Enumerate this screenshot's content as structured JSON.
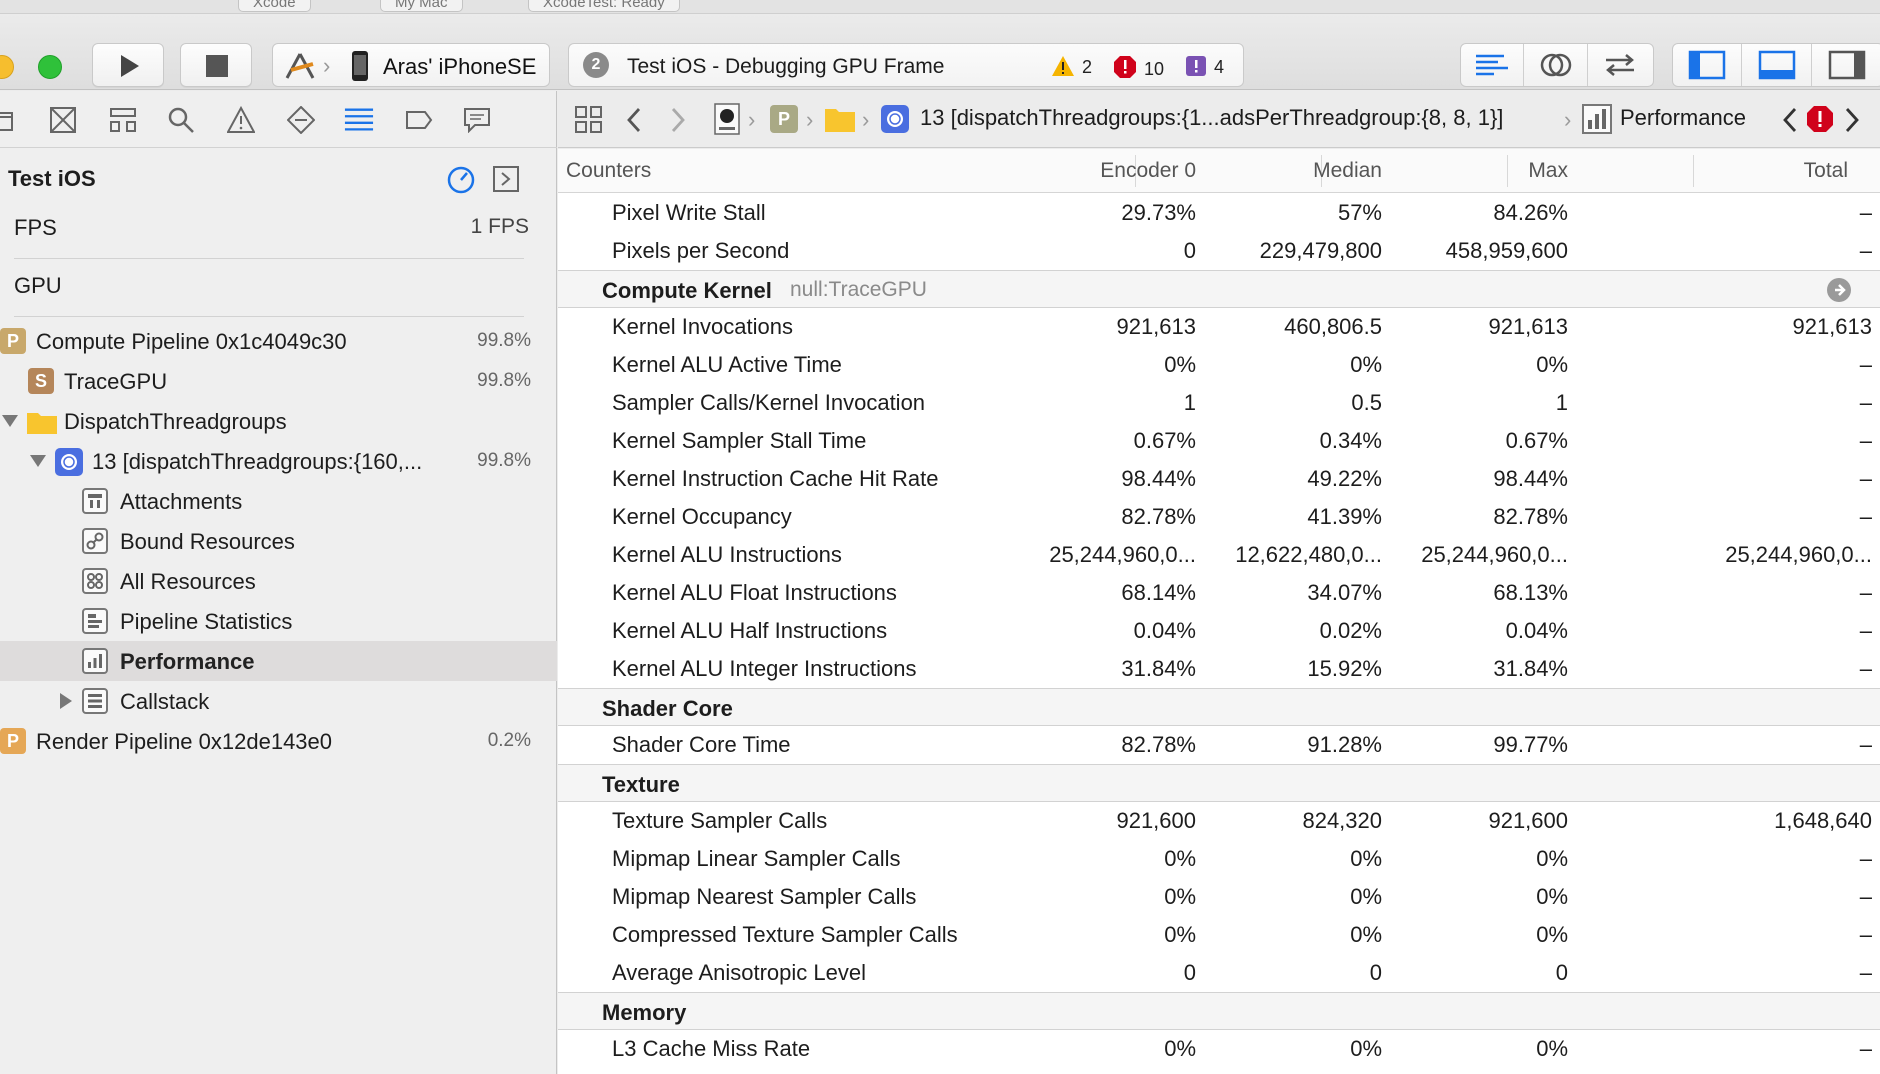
{
  "top_tabs": [
    "Xcode",
    "My Mac",
    "XcodeTest: Ready"
  ],
  "toolbar": {
    "device": "Aras' iPhoneSE",
    "activity_number": "2",
    "activity_status": "Test iOS - Debugging GPU Frame",
    "warnings": "2",
    "errors": "10",
    "issues": "4"
  },
  "navigator": {
    "title": "Test iOS",
    "fps_label": "FPS",
    "fps_value": "1 FPS",
    "gpu_label": "GPU",
    "items": [
      {
        "label": "Compute Pipeline 0x1c4049c30",
        "pct": "99.8%"
      },
      {
        "label": "TraceGPU",
        "pct": "99.8%"
      },
      {
        "label": "DispatchThreadgroups",
        "pct": ""
      },
      {
        "label": "13 [dispatchThreadgroups:{160,...",
        "pct": "99.8%"
      },
      {
        "label": "Attachments",
        "pct": ""
      },
      {
        "label": "Bound Resources",
        "pct": ""
      },
      {
        "label": "All Resources",
        "pct": ""
      },
      {
        "label": "Pipeline Statistics",
        "pct": ""
      },
      {
        "label": "Performance",
        "pct": ""
      },
      {
        "label": "Callstack",
        "pct": ""
      },
      {
        "label": "Render Pipeline 0x12de143e0",
        "pct": "0.2%"
      }
    ]
  },
  "jumpbar": {
    "call": "13 [dispatchThreadgroups:{1...adsPerThreadgroup:{8, 8, 1}]",
    "page": "Performance"
  },
  "table": {
    "columns": [
      "Counters",
      "Encoder 0",
      "Median",
      "Max",
      "Total"
    ],
    "rows": [
      {
        "type": "row",
        "name": "Pixel Write Stall",
        "v": [
          "29.73%",
          "57%",
          "84.26%",
          "–"
        ]
      },
      {
        "type": "row",
        "name": "Pixels per Second",
        "v": [
          "0",
          "229,479,800",
          "458,959,600",
          "–"
        ]
      },
      {
        "type": "group",
        "name": "Compute Kernel",
        "sub": "null:TraceGPU"
      },
      {
        "type": "row",
        "name": "Kernel Invocations",
        "v": [
          "921,613",
          "460,806.5",
          "921,613",
          "921,613"
        ]
      },
      {
        "type": "row",
        "name": "Kernel ALU Active Time",
        "v": [
          "0%",
          "0%",
          "0%",
          "–"
        ]
      },
      {
        "type": "row",
        "name": "Sampler Calls/Kernel Invocation",
        "v": [
          "1",
          "0.5",
          "1",
          "–"
        ]
      },
      {
        "type": "row",
        "name": "Kernel Sampler Stall Time",
        "v": [
          "0.67%",
          "0.34%",
          "0.67%",
          "–"
        ]
      },
      {
        "type": "row",
        "name": "Kernel Instruction Cache Hit Rate",
        "v": [
          "98.44%",
          "49.22%",
          "98.44%",
          "–"
        ]
      },
      {
        "type": "row",
        "name": "Kernel Occupancy",
        "v": [
          "82.78%",
          "41.39%",
          "82.78%",
          "–"
        ]
      },
      {
        "type": "row",
        "name": "Kernel ALU Instructions",
        "v": [
          "25,244,960,0...",
          "12,622,480,0...",
          "25,244,960,0...",
          "25,244,960,0..."
        ]
      },
      {
        "type": "row",
        "name": "Kernel ALU Float Instructions",
        "v": [
          "68.14%",
          "34.07%",
          "68.13%",
          "–"
        ]
      },
      {
        "type": "row",
        "name": "Kernel ALU Half Instructions",
        "v": [
          "0.04%",
          "0.02%",
          "0.04%",
          "–"
        ]
      },
      {
        "type": "row",
        "name": "Kernel ALU Integer Instructions",
        "v": [
          "31.84%",
          "15.92%",
          "31.84%",
          "–"
        ]
      },
      {
        "type": "group",
        "name": "Shader Core",
        "sub": ""
      },
      {
        "type": "row",
        "name": "Shader Core Time",
        "v": [
          "82.78%",
          "91.28%",
          "99.77%",
          "–"
        ]
      },
      {
        "type": "group",
        "name": "Texture",
        "sub": ""
      },
      {
        "type": "row",
        "name": "Texture Sampler Calls",
        "v": [
          "921,600",
          "824,320",
          "921,600",
          "1,648,640"
        ]
      },
      {
        "type": "row",
        "name": "Mipmap Linear Sampler Calls",
        "v": [
          "0%",
          "0%",
          "0%",
          "–"
        ]
      },
      {
        "type": "row",
        "name": "Mipmap Nearest Sampler Calls",
        "v": [
          "0%",
          "0%",
          "0%",
          "–"
        ]
      },
      {
        "type": "row",
        "name": "Compressed Texture Sampler Calls",
        "v": [
          "0%",
          "0%",
          "0%",
          "–"
        ]
      },
      {
        "type": "row",
        "name": "Average Anisotropic Level",
        "v": [
          "0",
          "0",
          "0",
          "–"
        ]
      },
      {
        "type": "group",
        "name": "Memory",
        "sub": ""
      },
      {
        "type": "row",
        "name": "L3 Cache Miss Rate",
        "v": [
          "0%",
          "0%",
          "0%",
          "–"
        ]
      }
    ]
  },
  "colors": {
    "accent_blue": "#1a73e8",
    "warning": "#f5b400",
    "error": "#d0021b",
    "issue": "#7a52b3",
    "pipeline_icon": "#c8a86b"
  }
}
